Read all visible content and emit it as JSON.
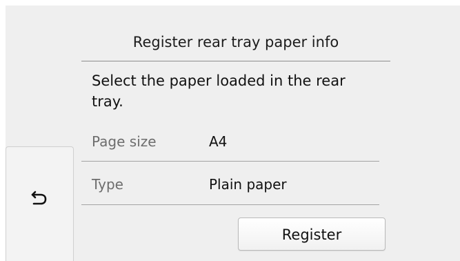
{
  "screen": {
    "title": "Register rear tray paper info",
    "message": "Select the paper loaded in the rear tray."
  },
  "fields": [
    {
      "label": "Page size",
      "value": "A4"
    },
    {
      "label": "Type",
      "value": "Plain paper"
    }
  ],
  "buttons": {
    "back_icon": "return-arrow-icon",
    "register_label": "Register"
  },
  "colors": {
    "panel_background": "#efefef",
    "divider": "#a3a3a3",
    "secondary_text": "#6d6d6d"
  }
}
